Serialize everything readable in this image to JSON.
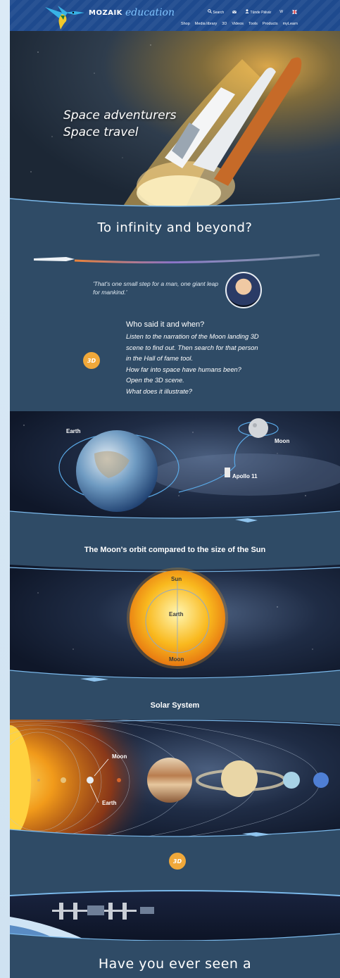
{
  "header": {
    "brand": "MOZAIK",
    "brand_suffix": "education",
    "search_label": "Search",
    "user_name": "Tünde Pálvár",
    "lang_code": "W",
    "nav": [
      "Shop",
      "Media library",
      "3D",
      "Videos",
      "Tools",
      "Products",
      "myLearn"
    ],
    "colors": {
      "bar": "#1e4a8e",
      "accent": "#7fc4ff"
    }
  },
  "hero": {
    "title_line1": "Space adventurers",
    "title_line2": "Space travel"
  },
  "intro": {
    "heading": "To infinity and beyond?",
    "quote": "'That's one small step for a man, one giant leap for mankind.'",
    "question_heading": "Who said it and when?",
    "lines": [
      "Listen to the narration of the Moon landing 3D",
      "scene to find out. Then search for that person",
      "in the Hall of fame tool.",
      "How far into space have humans been?",
      "Open the 3D scene.",
      "What does it illustrate?"
    ],
    "badge": "3D"
  },
  "moon_scene": {
    "earth_label": "Earth",
    "moon_label": "Moon",
    "apollo_label": "Apollo 11"
  },
  "sun_section": {
    "caption": "The Moon's orbit compared to the size of the Sun",
    "sun_label": "Sun",
    "earth_label": "Earth",
    "moon_label": "Moon"
  },
  "solar_section": {
    "caption": "Solar System",
    "moon_label": "Moon",
    "earth_label": "Earth",
    "badge": "3D"
  },
  "bottom": {
    "heading": "Have you ever seen a"
  }
}
